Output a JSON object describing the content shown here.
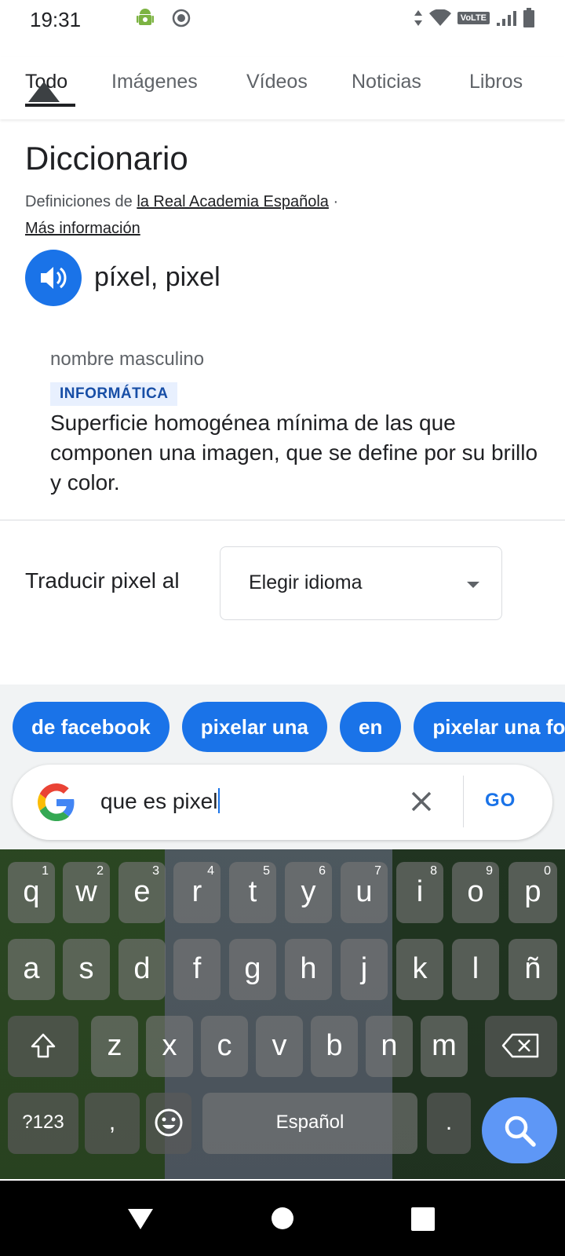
{
  "status_bar": {
    "time": "19:31",
    "network_badge": "VoLTE",
    "icons": [
      "android-debug-icon",
      "screen-record-icon",
      "data-arrows-icon",
      "wifi-icon",
      "signal-icon",
      "battery-icon"
    ]
  },
  "tabs": [
    {
      "label": "Todo",
      "active": true
    },
    {
      "label": "Imágenes",
      "active": false
    },
    {
      "label": "Vídeos",
      "active": false
    },
    {
      "label": "Noticias",
      "active": false
    },
    {
      "label": "Libros",
      "active": false
    }
  ],
  "dictionary": {
    "title": "Diccionario",
    "source_prefix": "Definiciones de",
    "source_link": "la Real Academia Española",
    "source_sep": "·",
    "more_info": "Más información",
    "word": "píxel, pixel",
    "part_of_speech": "nombre masculino",
    "domain": "INFORMÁTICA",
    "definition": "Superficie homogénea mínima de las que componen una imagen, que se define por su brillo y color."
  },
  "translate": {
    "label": "Traducir pixel al",
    "select_value": "Elegir idioma"
  },
  "suggestions": [
    "de facebook",
    "pixelar una",
    "en",
    "pixelar una fo"
  ],
  "search": {
    "query": "que es pixel",
    "go_label": "GO"
  },
  "keyboard": {
    "row1": [
      {
        "key": "q",
        "hint": "1"
      },
      {
        "key": "w",
        "hint": "2"
      },
      {
        "key": "e",
        "hint": "3"
      },
      {
        "key": "r",
        "hint": "4"
      },
      {
        "key": "t",
        "hint": "5"
      },
      {
        "key": "y",
        "hint": "6"
      },
      {
        "key": "u",
        "hint": "7"
      },
      {
        "key": "i",
        "hint": "8"
      },
      {
        "key": "o",
        "hint": "9"
      },
      {
        "key": "p",
        "hint": "0"
      }
    ],
    "row2": [
      "a",
      "s",
      "d",
      "f",
      "g",
      "h",
      "j",
      "k",
      "l",
      "ñ"
    ],
    "row3": [
      "z",
      "x",
      "c",
      "v",
      "b",
      "n",
      "m"
    ],
    "symbols_key": "?123",
    "comma_key": ",",
    "space_label": "Español",
    "period_key": "."
  },
  "colors": {
    "accent": "#1a73e8",
    "badge_bg": "#e8f0fe",
    "badge_text": "#174ea6"
  }
}
